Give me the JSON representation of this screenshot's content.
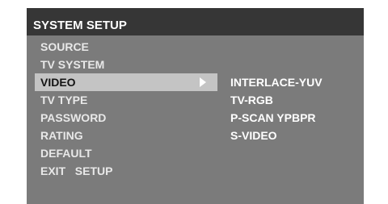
{
  "header": {
    "title": "SYSTEM SETUP"
  },
  "menu": {
    "items": [
      {
        "label": "SOURCE",
        "selected": false
      },
      {
        "label": "TV SYSTEM",
        "selected": false
      },
      {
        "label": "VIDEO",
        "selected": true
      },
      {
        "label": "TV TYPE",
        "selected": false
      },
      {
        "label": "PASSWORD",
        "selected": false
      },
      {
        "label": "RATING",
        "selected": false
      },
      {
        "label": "DEFAULT",
        "selected": false
      },
      {
        "label": "EXIT   SETUP",
        "selected": false
      }
    ]
  },
  "submenu": {
    "indicator_icon": "triangle-right-icon",
    "items": [
      {
        "label": "INTERLACE-YUV"
      },
      {
        "label": "TV-RGB"
      },
      {
        "label": "P-SCAN YPBPR"
      },
      {
        "label": "S-VIDEO"
      }
    ]
  },
  "colors": {
    "header_bg": "#363636",
    "panel_bg": "#7b7b7b",
    "selection_bg": "#c4c4c4",
    "text": "#e8e8e8"
  }
}
